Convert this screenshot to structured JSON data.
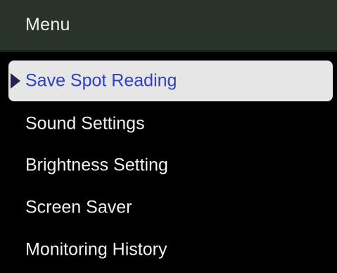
{
  "header": {
    "title": "Menu"
  },
  "menu": {
    "selected_index": 0,
    "items": [
      {
        "label": "Save Spot Reading"
      },
      {
        "label": "Sound Settings"
      },
      {
        "label": "Brightness Setting"
      },
      {
        "label": "Screen Saver"
      },
      {
        "label": "Monitoring History"
      }
    ]
  },
  "colors": {
    "header_bg": "#2a332a",
    "background": "#000000",
    "selected_bg": "#e6e6e6",
    "selected_text": "#2f3fc8",
    "text": "#f2f2f2"
  },
  "icons": {
    "selection_pointer": "triangle-right-icon"
  }
}
